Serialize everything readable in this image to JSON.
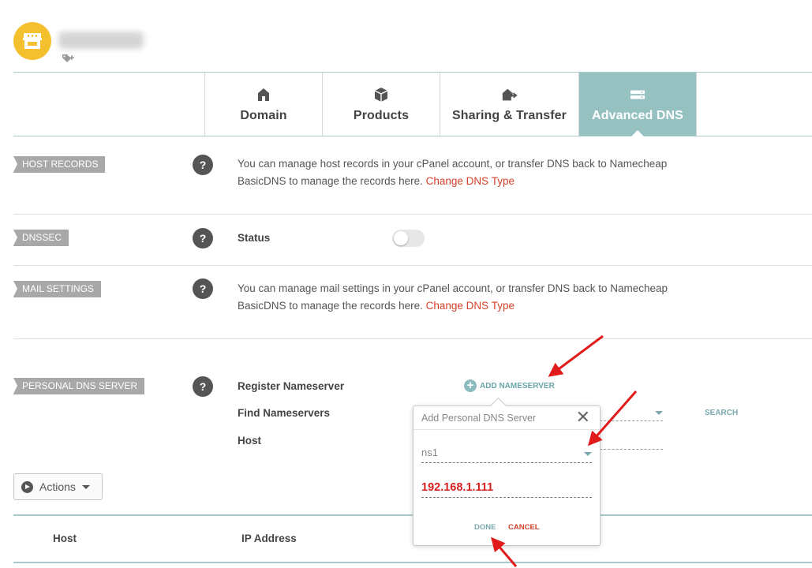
{
  "header": {
    "avatar_icon": "storefront-icon",
    "accent": "#f5c02e"
  },
  "tabs": [
    {
      "label": "Domain",
      "icon": "home-icon",
      "active": false
    },
    {
      "label": "Products",
      "icon": "box-icon",
      "active": false
    },
    {
      "label": "Sharing & Transfer",
      "icon": "house-arrow-icon",
      "active": false
    },
    {
      "label": "Advanced DNS",
      "icon": "server-icon",
      "active": true
    }
  ],
  "sections": {
    "host_records": {
      "tag": "HOST RECORDS",
      "text": "You can manage host records in your cPanel account, or transfer DNS back to Namecheap BasicDNS to manage the records here.",
      "link": "Change DNS Type"
    },
    "dnssec": {
      "tag": "DNSSEC",
      "status_label": "Status",
      "enabled": false
    },
    "mail_settings": {
      "tag": "MAIL SETTINGS",
      "text": "You can manage mail settings in your cPanel account, or transfer DNS back to Namecheap BasicDNS to manage the records here.",
      "link": "Change DNS Type"
    },
    "personal_dns": {
      "tag": "PERSONAL DNS SERVER",
      "register_label": "Register Nameserver",
      "add_label": "ADD NAMESERVER",
      "find_label": "Find Nameservers",
      "host_label": "Host",
      "search_label": "SEARCH"
    }
  },
  "help_glyph": "?",
  "actions": {
    "label": "Actions"
  },
  "table": {
    "columns": [
      "Host",
      "IP Address"
    ]
  },
  "popup": {
    "title": "Add Personal DNS Server",
    "close": "✕",
    "nameserver_value": "ns1",
    "ip_value": "192.168.1.111",
    "done": "DONE",
    "cancel": "CANCEL"
  },
  "colors": {
    "active_tab": "#96c1c1",
    "link": "#d4412a",
    "teal": "#7aa9ad",
    "annotation_red": "#e11b1b"
  }
}
